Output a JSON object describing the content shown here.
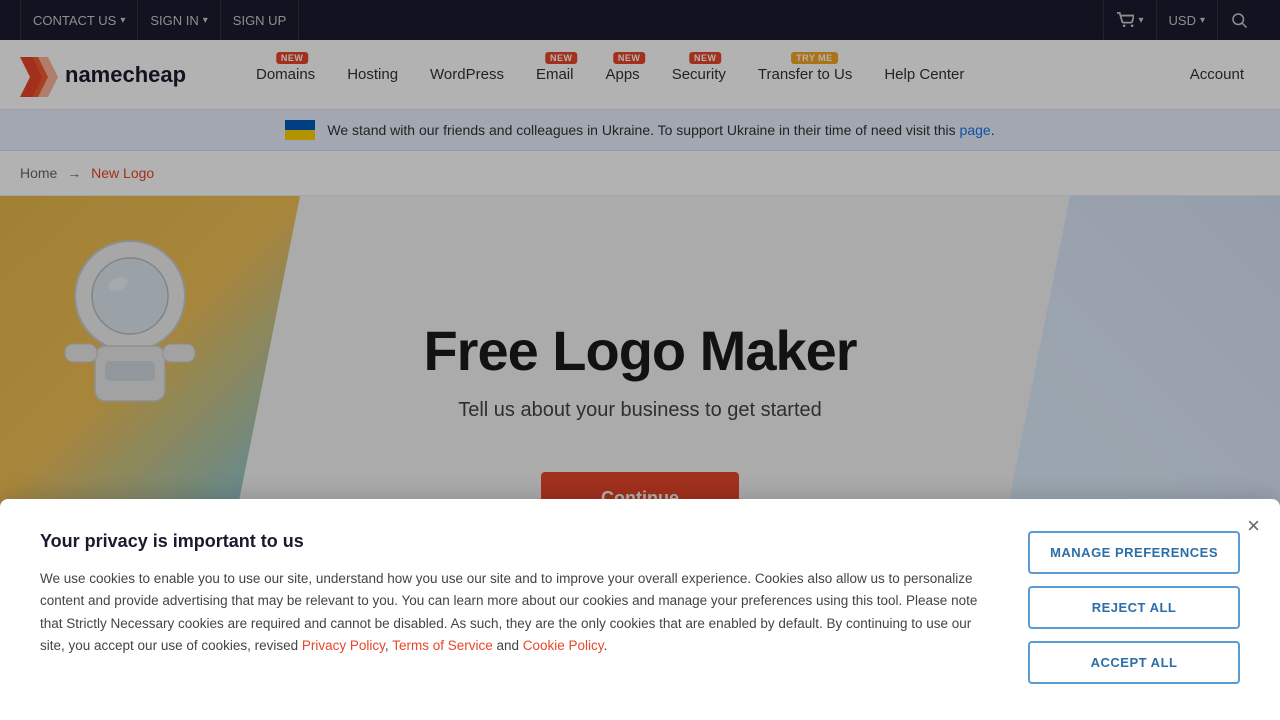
{
  "topbar": {
    "contact_us": "CONTACT US",
    "sign_in": "SIGN IN",
    "sign_up": "SIGN UP",
    "usd_label": "USD",
    "cart_label": ""
  },
  "navbar": {
    "logo_alt": "Namecheap",
    "items": [
      {
        "id": "domains",
        "label": "Domains",
        "badge": "NEW",
        "badgeType": "new"
      },
      {
        "id": "hosting",
        "label": "Hosting",
        "badge": null
      },
      {
        "id": "wordpress",
        "label": "WordPress",
        "badge": null
      },
      {
        "id": "email",
        "label": "Email",
        "badge": "NEW",
        "badgeType": "new"
      },
      {
        "id": "apps",
        "label": "Apps",
        "badge": "NEW",
        "badgeType": "new"
      },
      {
        "id": "security",
        "label": "Security",
        "badge": "NEW",
        "badgeType": "new"
      },
      {
        "id": "transfer",
        "label": "Transfer to Us",
        "badge": "TRY ME",
        "badgeType": "tryme"
      },
      {
        "id": "helpcenter",
        "label": "Help Center",
        "badge": null
      },
      {
        "id": "account",
        "label": "Account",
        "badge": null
      }
    ]
  },
  "ukraine_banner": {
    "text": "We stand with our friends and colleagues in Ukraine. To support Ukraine in their time of need visit this ",
    "link_text": "page",
    "suffix": "."
  },
  "breadcrumb": {
    "home_label": "Home",
    "arrow": "→",
    "current": "New Logo"
  },
  "hero": {
    "title": "Free Logo Maker",
    "subtitle": "Tell us about your business to get started",
    "continue_btn": "Continue"
  },
  "cookie": {
    "title": "Your privacy is important to us",
    "body": "We use cookies to enable you to use our site, understand how you use our site and to improve your overall experience. Cookies also allow us to personalize content and provide advertising that may be relevant to you. You can learn more about our cookies and manage your preferences using this tool. Please note that Strictly Necessary cookies are required and cannot be disabled. As such, they are the only cookies that are enabled by default. By continuing to use our site, you accept our use of cookies, revised ",
    "privacy_label": "Privacy Policy",
    "comma": ",",
    "terms_label": "Terms of Service",
    "and": " and ",
    "cookie_policy_label": "Cookie Policy",
    "period": ".",
    "manage_btn": "MANAGE PREFERENCES",
    "reject_btn": "REJECT ALL",
    "accept_btn": "ACCEPT ALL",
    "close_symbol": "×"
  }
}
